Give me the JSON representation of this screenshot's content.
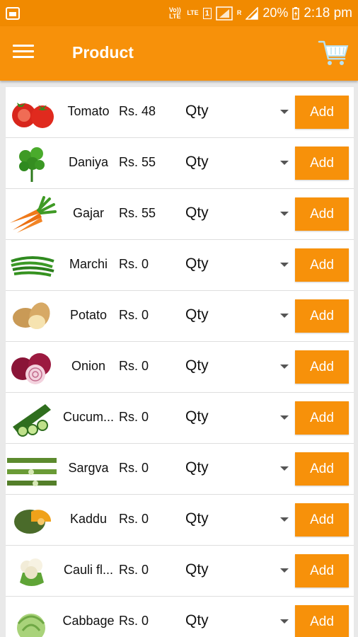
{
  "status_bar": {
    "volte": "Vo)) LTE",
    "lte": "LTE",
    "sim1": "1",
    "r_label": "R",
    "battery": "20%",
    "time": "2:18 pm"
  },
  "app_bar": {
    "title": "Product"
  },
  "colors": {
    "accent": "#f7910a",
    "status_bar": "#f18a00"
  },
  "products": [
    {
      "name": "Tomato",
      "price": "Rs. 48",
      "qty_label": "Qty",
      "add_label": "Add",
      "icon": "tomato-icon"
    },
    {
      "name": "Daniya",
      "price": "Rs. 55",
      "qty_label": "Qty",
      "add_label": "Add",
      "icon": "coriander-icon"
    },
    {
      "name": "Gajar",
      "price": "Rs. 55",
      "qty_label": "Qty",
      "add_label": "Add",
      "icon": "carrot-icon"
    },
    {
      "name": "Marchi",
      "price": "Rs. 0",
      "qty_label": "Qty",
      "add_label": "Add",
      "icon": "chili-icon"
    },
    {
      "name": "Potato",
      "price": "Rs. 0",
      "qty_label": "Qty",
      "add_label": "Add",
      "icon": "potato-icon"
    },
    {
      "name": "Onion",
      "price": "Rs. 0",
      "qty_label": "Qty",
      "add_label": "Add",
      "icon": "onion-icon"
    },
    {
      "name": "Cucum...",
      "price": "Rs. 0",
      "qty_label": "Qty",
      "add_label": "Add",
      "icon": "cucumber-icon"
    },
    {
      "name": "Sargva",
      "price": "Rs. 0",
      "qty_label": "Qty",
      "add_label": "Add",
      "icon": "drumstick-icon"
    },
    {
      "name": "Kaddu",
      "price": "Rs. 0",
      "qty_label": "Qty",
      "add_label": "Add",
      "icon": "pumpkin-icon"
    },
    {
      "name": "Cauli fl...",
      "price": "Rs. 0",
      "qty_label": "Qty",
      "add_label": "Add",
      "icon": "cauliflower-icon"
    },
    {
      "name": "Cabbage",
      "price": "Rs. 0",
      "qty_label": "Qty",
      "add_label": "Add",
      "icon": "cabbage-icon"
    }
  ]
}
